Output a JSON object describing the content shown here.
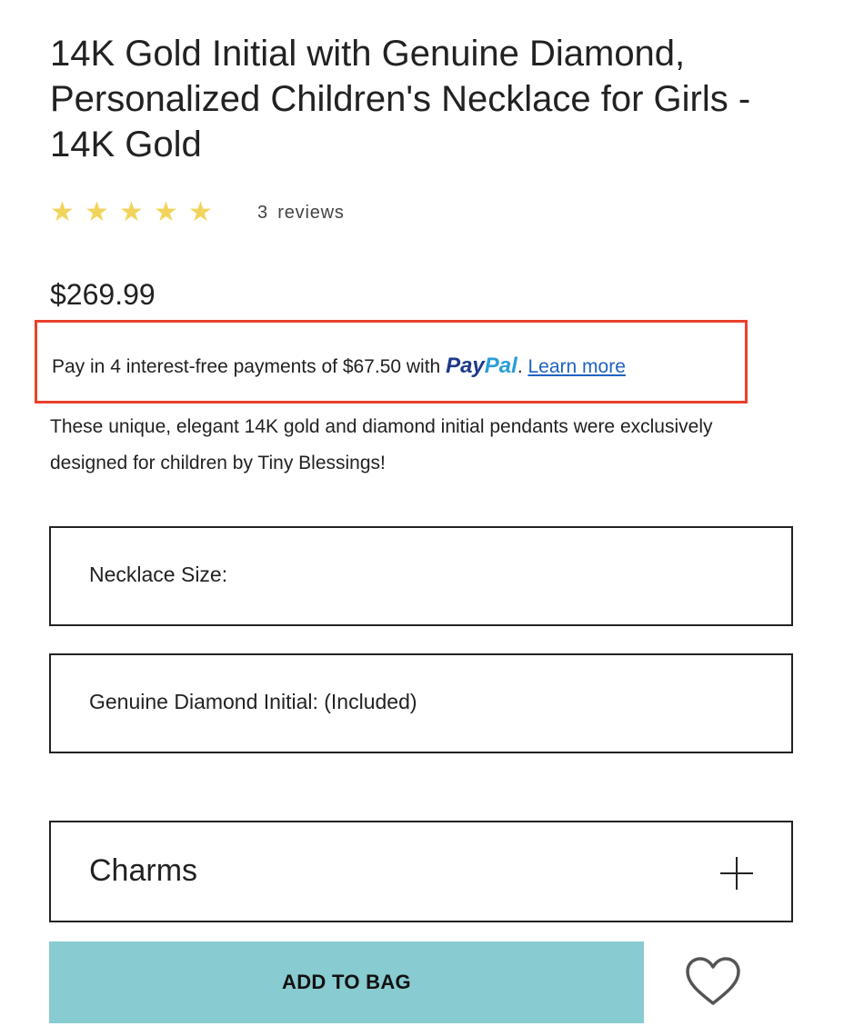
{
  "product": {
    "title": "14K Gold Initial with Genuine Diamond, Personalized Children's Necklace for Girls - 14K Gold",
    "rating": {
      "stars": 5,
      "max": 5,
      "reviews_count": "3",
      "reviews_label": "reviews"
    },
    "price": "$269.99",
    "description": "These unique, elegant 14K gold and diamond initial pendants were exclusively designed for children by Tiny Blessings!"
  },
  "paypal": {
    "prefix": "Pay in 4 interest-free payments of $67.50 with",
    "logo_pay": "Pay",
    "logo_pal": "Pal",
    "period": ".",
    "learn_more": "Learn more"
  },
  "options": {
    "necklace_size_label": "Necklace Size:",
    "diamond_initial_label": "Genuine Diamond Initial: (Included)"
  },
  "charms": {
    "label": "Charms"
  },
  "actions": {
    "add_to_bag": "ADD TO BAG"
  },
  "colors": {
    "star": "#f2d45c",
    "highlight_border": "#e8402c",
    "add_button_bg": "#88cbd0",
    "paypal_dark": "#1c3a8a",
    "paypal_light": "#2a9ed8",
    "link": "#1e63c0"
  },
  "icons": {
    "star": "star-icon",
    "plus": "plus-icon",
    "heart": "heart-icon"
  }
}
